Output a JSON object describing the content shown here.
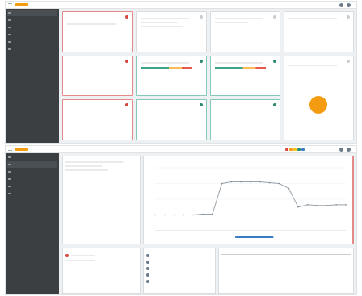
{
  "screen1": {
    "top_center": "",
    "nav_items": [
      "",
      "",
      "",
      "",
      "",
      ""
    ],
    "cards": [
      {
        "title": "",
        "stats": [
          {
            "v": "",
            "l": ""
          },
          {
            "v": "",
            "l": ""
          },
          {
            "v": "",
            "l": ""
          }
        ]
      },
      {
        "title": "",
        "stats": []
      },
      {
        "title": "",
        "stats": []
      },
      {
        "title": "",
        "stats": []
      },
      {
        "title": "",
        "stats": [
          {
            "v": "",
            "l": ""
          },
          {
            "v": "",
            "l": ""
          }
        ]
      },
      {
        "title": "",
        "stats": []
      },
      {
        "title": "",
        "stats": []
      },
      {
        "title": "",
        "stats": []
      },
      {
        "title": "",
        "stats": [
          {
            "v": "",
            "l": ""
          },
          {
            "v": "",
            "l": ""
          }
        ]
      },
      {
        "title": "",
        "stats": [
          {
            "v": "",
            "l": ""
          },
          {
            "v": "",
            "l": ""
          }
        ]
      },
      {
        "title": "",
        "stats": [
          {
            "v": "",
            "l": ""
          },
          {
            "v": "",
            "l": ""
          }
        ]
      },
      {
        "title": "",
        "stats": []
      }
    ]
  },
  "screen2": {
    "nav_items": [
      "",
      "",
      "",
      "",
      "",
      ""
    ],
    "left_panel_title": "",
    "chart_title": "",
    "bottom_left_title": "",
    "bottom_mid_title": "",
    "bottom_right_title": "",
    "events": [
      "",
      "",
      "",
      "",
      ""
    ]
  },
  "chart_data": {
    "type": "line",
    "title": "",
    "xlabel": "",
    "ylabel": "",
    "x": [
      0,
      5,
      10,
      15,
      20,
      25,
      30,
      35,
      40,
      45,
      50,
      55,
      60,
      65,
      70,
      75,
      80,
      85,
      90,
      95,
      100
    ],
    "series": [
      {
        "values": [
          20,
          20,
          20,
          20,
          20,
          21,
          21,
          60,
          62,
          62,
          62,
          62,
          61,
          60,
          54,
          30,
          33,
          32,
          32,
          33,
          33
        ]
      }
    ],
    "ylim": [
      0,
      80
    ],
    "grid": true
  },
  "colors": {
    "accent": "#f39c12",
    "danger": "#d9453c",
    "ok": "#2a8a74",
    "sidebar": "#3c3f42"
  }
}
